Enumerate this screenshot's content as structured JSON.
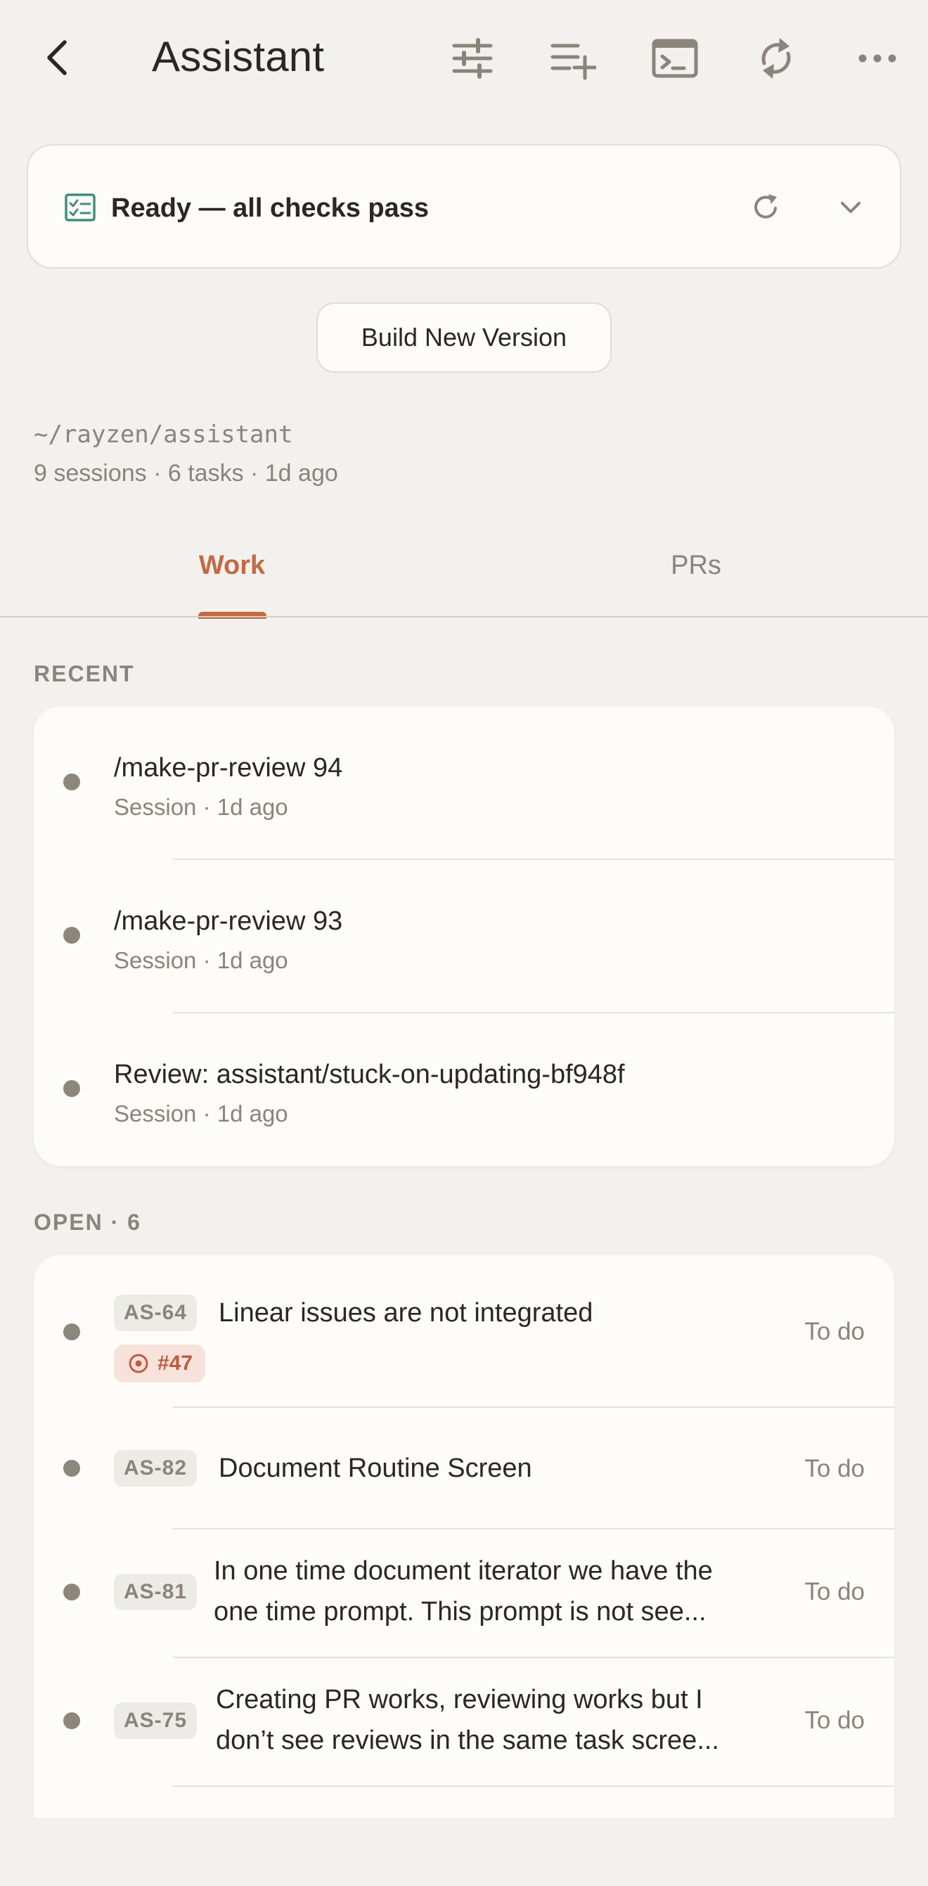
{
  "header": {
    "title": "Assistant",
    "icons": [
      "back-chevron-icon",
      "sliders-icon",
      "playlist-add-icon",
      "terminal-icon",
      "sync-icon",
      "more-horizontal-icon"
    ]
  },
  "status_card": {
    "text": "Ready — all checks pass",
    "icon": "checklist-icon",
    "icon_color": "#3f8f77"
  },
  "build_button": {
    "label": "Build New Version"
  },
  "repo": {
    "path": "~/rayzen/assistant",
    "meta": "9 sessions · 6 tasks · 1d ago"
  },
  "tabs": [
    {
      "label": "Work",
      "active": true
    },
    {
      "label": "PRs",
      "active": false
    }
  ],
  "accent": "#c26a45",
  "recent": {
    "label": "RECENT",
    "items": [
      {
        "title": "/make-pr-review 94",
        "subtitle": "Session · 1d ago"
      },
      {
        "title": "/make-pr-review 93",
        "subtitle": "Session · 1d ago"
      },
      {
        "title": "Review: assistant/stuck-on-updating-bf948f",
        "subtitle": "Session · 1d ago"
      }
    ]
  },
  "open": {
    "label": "OPEN · 6",
    "items": [
      {
        "id": "AS-64",
        "title": "Linear issues are not integrated",
        "status": "To do",
        "pr": "#47"
      },
      {
        "id": "AS-82",
        "title": "Document Routine Screen",
        "status": "To do"
      },
      {
        "id": "AS-81",
        "title_line1": "In one time document iterator we have the",
        "title_line2": "one time prompt. This prompt is not see...",
        "status": "To do"
      },
      {
        "id": "AS-75",
        "title_line1": "Creating PR works, reviewing works but I",
        "title_line2": "don’t see reviews in the same task scree...",
        "status": "To do"
      }
    ]
  }
}
